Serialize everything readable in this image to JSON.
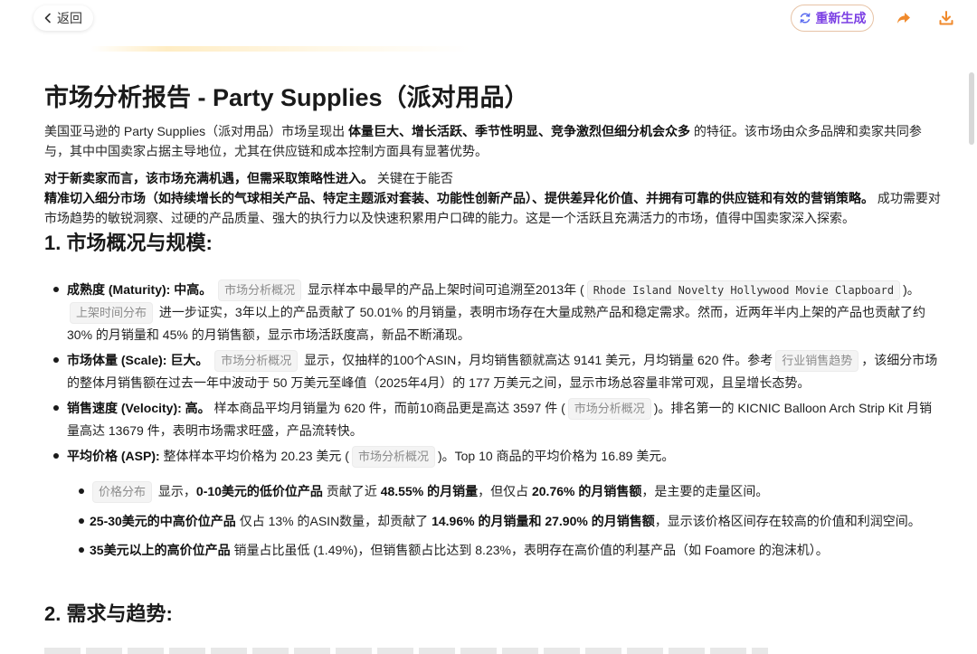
{
  "topbar": {
    "back_label": "返回",
    "regen_label": "重新生成",
    "accent": "#7b3fe4",
    "icons": [
      "chevron-left-icon",
      "refresh-icon",
      "share-icon",
      "download-icon"
    ]
  },
  "report": {
    "title": "市场分析报告 - Party Supplies（派对用品）",
    "intro": {
      "a": "美国亚马逊的 Party Supplies（派对用品）市场呈现出 ",
      "b": "体量巨大、增长活跃、季节性明显、竞争激烈但细分机会众多",
      "c": " 的特征。该市场由众多品牌和卖家共同参与，其中中国卖家占据主导地位，尤其在供应链和成本控制方面具有显著优势。"
    },
    "summary": {
      "b1": "对于新卖家而言，该市场充满机遇，但需采取策略性进入。",
      "t1": " 关键在于能否",
      "b2": "精准切入细分市场（如持续增长的气球相关产品、特定主题派对套装、功能性创新产品）、提供差异化价值、并拥有可靠的供应链和有效的营销策略。",
      "t2": " 成功需要对市场趋势的敏锐洞察、过硬的产品质量、强大的执行力以及快速积累用户口碑的能力。这是一个活跃且充满活力的市场，值得中国卖家深入探索。"
    },
    "section1_title": "1. 市场概况与规模:",
    "section2_title": "2. 需求与趋势:",
    "items": {
      "maturity": {
        "label": "成熟度 (Maturity): 中高。",
        "chip1": "市场分析概况",
        "t1": " 显示样本中最早的产品上架时间可追溯至2013年 (",
        "code": "Rhode Island Novelty Hollywood Movie Clapboard",
        "t2": ")。",
        "chip2": "上架时间分布",
        "t3": " 进一步证实，3年以上的产品贡献了 50.01% 的月销量，表明市场存在大量成熟产品和稳定需求。然而，近两年半内上架的产品也贡献了约 30% 的月销量和 45% 的月销售额，显示市场活跃度高，新品不断涌现。"
      },
      "scale": {
        "label": "市场体量 (Scale): 巨大。",
        "chip1": "市场分析概况",
        "t1": " 显示，仅抽样的100个ASIN，月均销售额就高达 9141 美元，月均销量 620 件。参考",
        "chip2": "行业销售趋势",
        "t2": "，该细分市场的整体月销售额在过去一年中波动于 50 万美元至峰值（2025年4月）的 177 万美元之间，显示市场总容量非常可观，且呈增长态势。"
      },
      "velocity": {
        "label": "销售速度 (Velocity): 高。",
        "t1": " 样本商品平均月销量为 620 件，而前10商品更是高达 3597 件 (",
        "chip1": "市场分析概况",
        "t2": ")。排名第一的 KICNIC Balloon Arch Strip Kit 月销量高达 13679 件，表明市场需求旺盛，产品流转快。"
      },
      "asp": {
        "label": "平均价格 (ASP):",
        "t1": " 整体样本平均价格为 20.23 美元 (",
        "chip1": "市场分析概况",
        "t2": ")。Top 10 商品的平均价格为 16.89 美元。",
        "sub": {
          "s1": {
            "chip": "价格分布",
            "t1": " 显示，",
            "b1": "0-10美元的低价位产品",
            "t2": " 贡献了近 ",
            "b2": "48.55% 的月销量",
            "t3": "，但仅占 ",
            "b3": "20.76% 的月销售额",
            "t4": "，是主要的走量区间。"
          },
          "s2": {
            "b1": "25-30美元的中高价位产品",
            "t1": " 仅占 13% 的ASIN数量，却贡献了 ",
            "b2": "14.96% 的月销量和 27.90% 的月销售额",
            "t2": "，显示该价格区间存在较高的价值和利润空间。"
          },
          "s3": {
            "b1": "35美元以上的高价位产品",
            "t1": " 销量占比虽低 (1.49%)，但销售额占比达到 8.23%，表明存在高价值的利基产品（如 Foamore 的泡沫机）。"
          }
        }
      }
    }
  }
}
